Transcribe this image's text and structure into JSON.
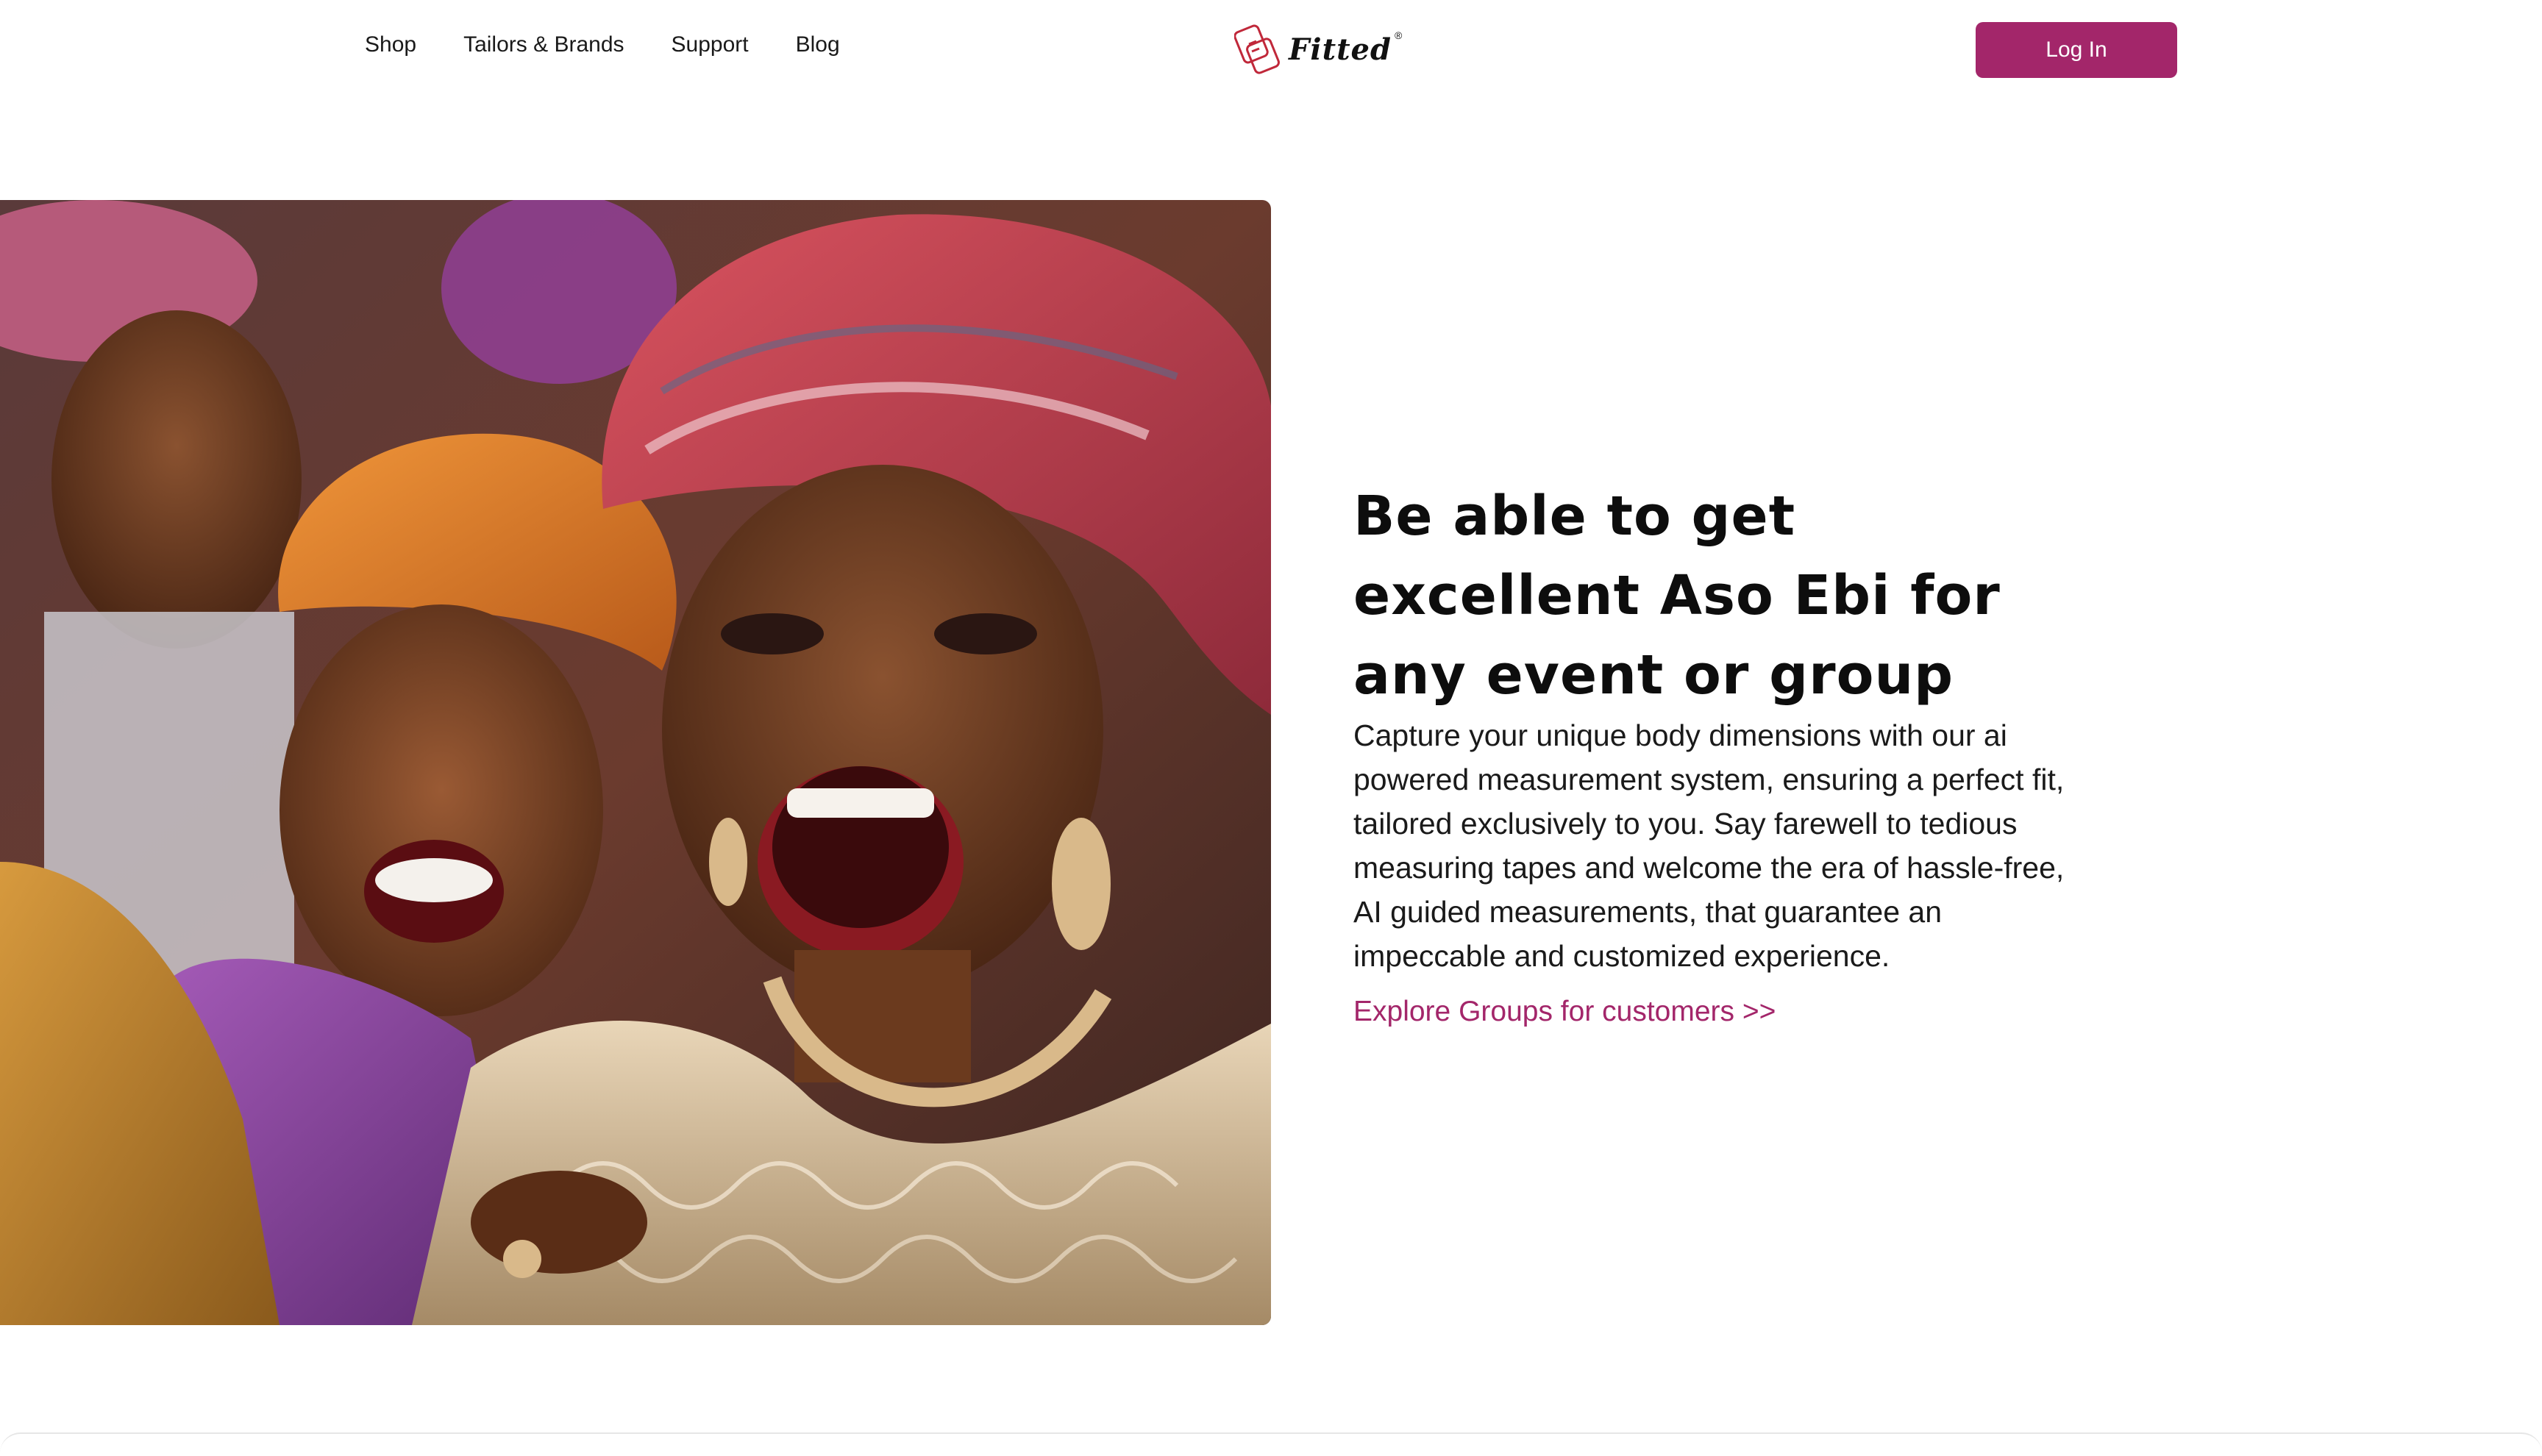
{
  "header": {
    "nav": [
      {
        "label": "Shop"
      },
      {
        "label": "Tailors & Brands"
      },
      {
        "label": "Support"
      },
      {
        "label": "Blog"
      }
    ],
    "logo": {
      "icon": "measuring-tape-icon",
      "text": "Fitted",
      "trademark": "®"
    },
    "login_label": "Log In"
  },
  "hero": {
    "image_icon": "hero-photo",
    "title": "Be able to get excellent Aso Ebi for any event or group",
    "body": "Capture your unique body dimensions with our ai powered measurement system, ensuring a perfect fit, tailored exclusively to you. Say farewell to tedious measuring tapes and welcome the era of hassle-free, AI guided measurements, that guarantee an impeccable and customized experience.",
    "link_label": "Explore Groups for customers >>"
  },
  "colors": {
    "accent": "#a3266a",
    "text": "#111111",
    "background": "#ffffff"
  }
}
